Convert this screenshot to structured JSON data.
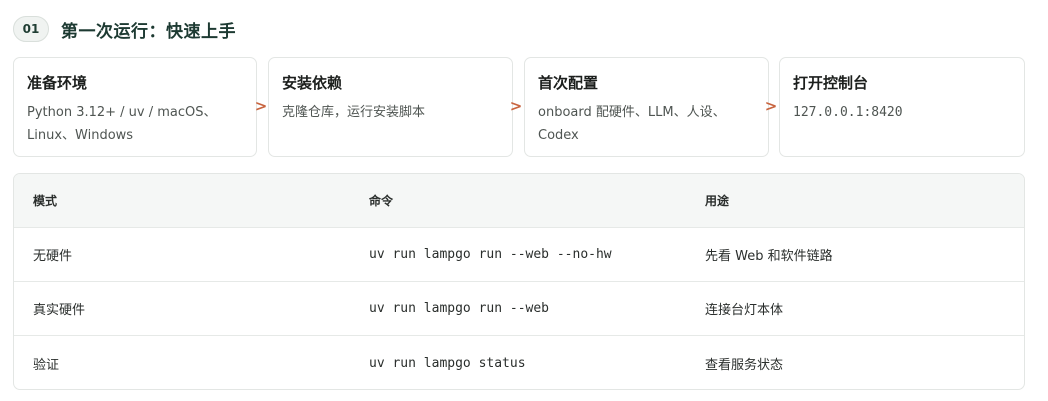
{
  "header": {
    "step_number": "01",
    "title": "第一次运行：快速上手"
  },
  "steps": [
    {
      "title": "准备环境",
      "desc_line1": "Python 3.12+ / uv / macOS、",
      "desc_line2": "Linux、Windows"
    },
    {
      "title": "安装依赖",
      "desc_line1": "克隆仓库，运行安装脚本",
      "desc_line2": ""
    },
    {
      "title": "首次配置",
      "desc_line1": "onboard 配硬件、LLM、人设、",
      "desc_line2": "Codex"
    },
    {
      "title": "打开控制台",
      "desc_line1": "127.0.0.1:8420",
      "desc_line2": ""
    }
  ],
  "arrow_glyph": ">",
  "colors": {
    "arrow": "#c8643f",
    "title": "#1d3a32"
  },
  "table": {
    "headers": [
      "模式",
      "命令",
      "用途"
    ],
    "rows": [
      [
        "无硬件",
        "uv run lampgo run --web --no-hw",
        "先看 Web 和软件链路"
      ],
      [
        "真实硬件",
        "uv run lampgo run --web",
        "连接台灯本体"
      ],
      [
        "验证",
        "uv run lampgo status",
        "查看服务状态"
      ]
    ]
  }
}
